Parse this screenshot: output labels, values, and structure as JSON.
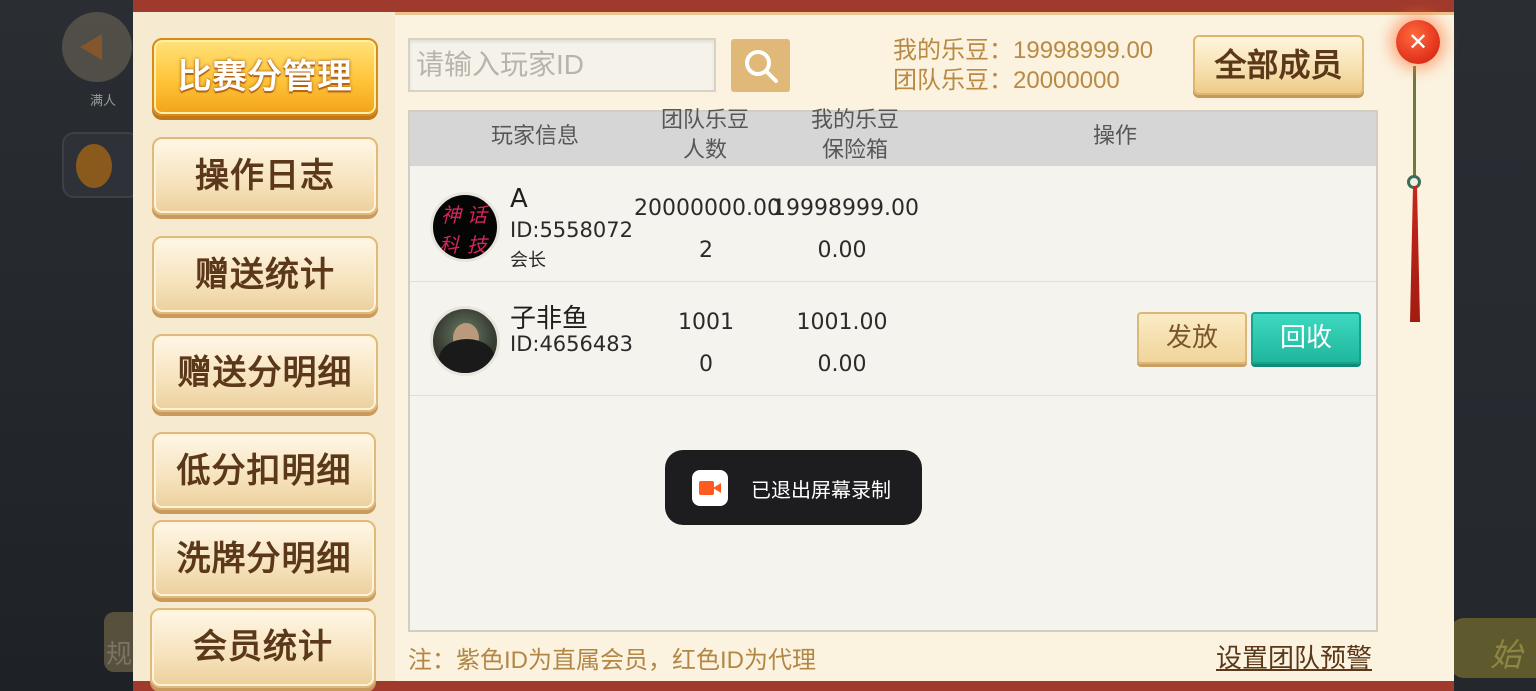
{
  "background": {
    "back_label": "满人",
    "rule_label": "规",
    "start_label": "始"
  },
  "sidebar": {
    "items": [
      {
        "label": "比赛分管理",
        "active": true
      },
      {
        "label": "操作日志"
      },
      {
        "label": "赠送统计"
      },
      {
        "label": "赠送分明细"
      },
      {
        "label": "低分扣明细"
      },
      {
        "label": "洗牌分明细"
      },
      {
        "label": "会员统计"
      }
    ]
  },
  "search": {
    "placeholder": "请输入玩家ID",
    "value": "",
    "icon": "search-icon"
  },
  "beans": {
    "my": "我的乐豆：19998999.00",
    "team": "团队乐豆：20000000"
  },
  "all_members_label": "全部成员",
  "close_label": "✕",
  "table": {
    "headers": {
      "player_info": "玩家信息",
      "team_beans_1": "团队乐豆",
      "team_beans_2": "人数",
      "my_beans_1": "我的乐豆",
      "my_beans_2": "保险箱",
      "operation": "操作"
    },
    "rows": [
      {
        "avatar_text": [
          "神",
          "话",
          "科",
          "技"
        ],
        "name": "A",
        "id": "ID:5558072",
        "role": "会长",
        "team_beans": "20000000.00",
        "members": "2",
        "my_beans": "19998999.00",
        "safe": "0.00"
      },
      {
        "name": "子非鱼",
        "id": "ID:4656483",
        "team_beans": "1001",
        "members": "0",
        "my_beans": "1001.00",
        "safe": "0.00",
        "give_label": "发放",
        "recall_label": "回收"
      }
    ]
  },
  "toast": {
    "text": "已退出屏幕录制",
    "icon": "screen-record-icon"
  },
  "footer": {
    "note": "注：紫色ID为直属会员，红色ID为代理",
    "warn_link": "设置团队预警"
  },
  "colors": {
    "accent_gold": "#f2a21a",
    "recall_teal": "#1fb69d",
    "note_text": "#b28745",
    "panel_border": "#a03a2d"
  }
}
